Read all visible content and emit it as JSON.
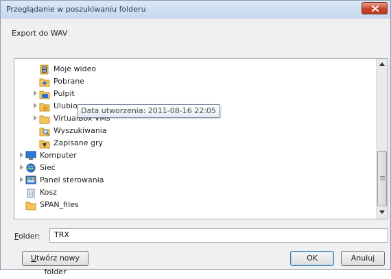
{
  "window": {
    "title": "Przeglądanie w poszukiwaniu folderu",
    "description": "Export do WAV"
  },
  "tree": {
    "items": [
      {
        "label": "Moje wideo",
        "icon": "video-library-icon",
        "expandable": false
      },
      {
        "label": "Pobrane",
        "icon": "downloads-folder-icon",
        "expandable": false
      },
      {
        "label": "Pulpit",
        "icon": "desktop-folder-icon",
        "expandable": true
      },
      {
        "label": "Ulubione",
        "icon": "favorites-folder-icon",
        "expandable": true
      },
      {
        "label": "VirtualBox VMs",
        "icon": "folder-icon",
        "expandable": true
      },
      {
        "label": "Wyszukiwania",
        "icon": "searches-folder-icon",
        "expandable": false
      },
      {
        "label": "Zapisane gry",
        "icon": "saved-games-icon",
        "expandable": false
      },
      {
        "label": "Komputer",
        "icon": "computer-icon",
        "expandable": true
      },
      {
        "label": "Sieć",
        "icon": "network-icon",
        "expandable": true
      },
      {
        "label": "Panel sterowania",
        "icon": "control-panel-icon",
        "expandable": true
      },
      {
        "label": "Kosz",
        "icon": "recycle-bin-icon",
        "expandable": false
      },
      {
        "label": "SPAN_files",
        "icon": "folder-icon",
        "expandable": false
      }
    ],
    "tooltip": "Data utworzenia: 2011-08-16 22:05"
  },
  "folder": {
    "label_prefix": "",
    "label_accel": "F",
    "label_rest": "older:",
    "value": "TRX"
  },
  "buttons": {
    "new_folder_accel": "U",
    "new_folder_rest": "twórz nowy folder",
    "ok": "OK",
    "cancel": "Anuluj"
  }
}
